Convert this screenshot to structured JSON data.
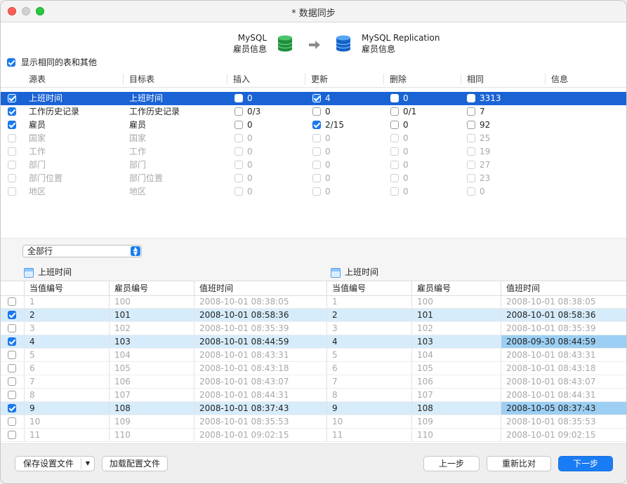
{
  "window": {
    "title": "* 数据同步"
  },
  "sync_header": {
    "source_line1": "MySQL",
    "source_line2": "雇员信息",
    "target_line1": "MySQL Replication",
    "target_line2": "雇员信息",
    "source_color": "#27a046",
    "target_color": "#1a7cf4"
  },
  "show_same_label": "显示相同的表和其他",
  "grid": {
    "headers": [
      "源表",
      "目标表",
      "插入",
      "更新",
      "删除",
      "相同",
      "信息"
    ],
    "rows": [
      {
        "checked": true,
        "source": "上班时间",
        "target": "上班时间",
        "insert_checked": false,
        "insert": "0",
        "update_checked": true,
        "update": "4",
        "delete_checked": false,
        "delete": "0",
        "same_checked": false,
        "same": "3313",
        "selected": true,
        "dim": false
      },
      {
        "checked": true,
        "source": "工作历史记录",
        "target": "工作历史记录",
        "insert_checked": false,
        "insert": "0/3",
        "update_checked": false,
        "update": "0",
        "delete_checked": false,
        "delete": "0/1",
        "same_checked": false,
        "same": "7",
        "selected": false,
        "dim": false
      },
      {
        "checked": true,
        "source": "雇员",
        "target": "雇员",
        "insert_checked": false,
        "insert": "0",
        "update_checked": true,
        "update": "2/15",
        "delete_checked": false,
        "delete": "0",
        "same_checked": false,
        "same": "92",
        "selected": false,
        "dim": false
      },
      {
        "checked": false,
        "source": "国家",
        "target": "国家",
        "insert_checked": false,
        "insert": "0",
        "update_checked": false,
        "update": "0",
        "delete_checked": false,
        "delete": "0",
        "same_checked": false,
        "same": "25",
        "selected": false,
        "dim": true
      },
      {
        "checked": false,
        "source": "工作",
        "target": "工作",
        "insert_checked": false,
        "insert": "0",
        "update_checked": false,
        "update": "0",
        "delete_checked": false,
        "delete": "0",
        "same_checked": false,
        "same": "19",
        "selected": false,
        "dim": true
      },
      {
        "checked": false,
        "source": "部门",
        "target": "部门",
        "insert_checked": false,
        "insert": "0",
        "update_checked": false,
        "update": "0",
        "delete_checked": false,
        "delete": "0",
        "same_checked": false,
        "same": "27",
        "selected": false,
        "dim": true
      },
      {
        "checked": false,
        "source": "部门位置",
        "target": "部门位置",
        "insert_checked": false,
        "insert": "0",
        "update_checked": false,
        "update": "0",
        "delete_checked": false,
        "delete": "0",
        "same_checked": false,
        "same": "23",
        "selected": false,
        "dim": true
      },
      {
        "checked": false,
        "source": "地区",
        "target": "地区",
        "insert_checked": false,
        "insert": "0",
        "update_checked": false,
        "update": "0",
        "delete_checked": false,
        "delete": "0",
        "same_checked": false,
        "same": "0",
        "selected": false,
        "dim": true
      }
    ]
  },
  "filter": {
    "selected": "全部行"
  },
  "compare": {
    "left_table": "上班时间",
    "right_table": "上班时间",
    "headers": [
      "当值编号",
      "雇员编号",
      "值班时间",
      "当值编号",
      "雇员编号",
      "值班时间"
    ],
    "rows": [
      {
        "checked": false,
        "diff": false,
        "l_id": "1",
        "l_emp": "100",
        "l_time": "2008-10-01 08:38:05",
        "r_id": "1",
        "r_emp": "100",
        "r_time": "2008-10-01 08:38:05",
        "r_changed": false
      },
      {
        "checked": true,
        "diff": true,
        "l_id": "2",
        "l_emp": "101",
        "l_time": "2008-10-01 08:58:36",
        "r_id": "2",
        "r_emp": "101",
        "r_time": "2008-10-01 08:58:36",
        "r_changed": false
      },
      {
        "checked": false,
        "diff": false,
        "l_id": "3",
        "l_emp": "102",
        "l_time": "2008-10-01 08:35:39",
        "r_id": "3",
        "r_emp": "102",
        "r_time": "2008-10-01 08:35:39",
        "r_changed": false
      },
      {
        "checked": true,
        "diff": true,
        "l_id": "4",
        "l_emp": "103",
        "l_time": "2008-10-01 08:44:59",
        "r_id": "4",
        "r_emp": "103",
        "r_time": "2008-09-30 08:44:59",
        "r_changed": true
      },
      {
        "checked": false,
        "diff": false,
        "l_id": "5",
        "l_emp": "104",
        "l_time": "2008-10-01 08:43:31",
        "r_id": "5",
        "r_emp": "104",
        "r_time": "2008-10-01 08:43:31",
        "r_changed": false
      },
      {
        "checked": false,
        "diff": false,
        "l_id": "6",
        "l_emp": "105",
        "l_time": "2008-10-01 08:43:18",
        "r_id": "6",
        "r_emp": "105",
        "r_time": "2008-10-01 08:43:18",
        "r_changed": false
      },
      {
        "checked": false,
        "diff": false,
        "l_id": "7",
        "l_emp": "106",
        "l_time": "2008-10-01 08:43:07",
        "r_id": "7",
        "r_emp": "106",
        "r_time": "2008-10-01 08:43:07",
        "r_changed": false
      },
      {
        "checked": false,
        "diff": false,
        "l_id": "8",
        "l_emp": "107",
        "l_time": "2008-10-01 08:44:31",
        "r_id": "8",
        "r_emp": "107",
        "r_time": "2008-10-01 08:44:31",
        "r_changed": false
      },
      {
        "checked": true,
        "diff": true,
        "l_id": "9",
        "l_emp": "108",
        "l_time": "2008-10-01 08:37:43",
        "r_id": "9",
        "r_emp": "108",
        "r_time": "2008-10-05 08:37:43",
        "r_changed": true
      },
      {
        "checked": false,
        "diff": false,
        "l_id": "10",
        "l_emp": "109",
        "l_time": "2008-10-01 08:35:53",
        "r_id": "10",
        "r_emp": "109",
        "r_time": "2008-10-01 08:35:53",
        "r_changed": false
      },
      {
        "checked": false,
        "diff": false,
        "l_id": "11",
        "l_emp": "110",
        "l_time": "2008-10-01 09:02:15",
        "r_id": "11",
        "r_emp": "110",
        "r_time": "2008-10-01 09:02:15",
        "r_changed": false
      }
    ]
  },
  "footer": {
    "save_settings": "保存设置文件",
    "load_settings": "加载配置文件",
    "prev": "上一步",
    "recompare": "重新比对",
    "next": "下一步"
  }
}
